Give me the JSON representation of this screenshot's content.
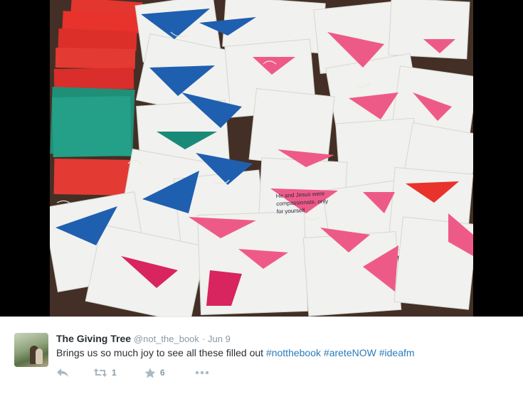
{
  "tweet": {
    "display_name": "The Giving Tree",
    "handle": "@not_the_book",
    "separator": "·",
    "date": "Jun 9",
    "text": "Brings us so much joy to see all these filled out",
    "hashtags": [
      "#notthebook",
      "#areteNOW",
      "#ideafm"
    ],
    "retweet_count": "1",
    "favorite_count": "6"
  },
  "icons": {
    "reply": "reply-icon",
    "retweet": "retweet-icon",
    "favorite": "star-icon",
    "more": "more-icon"
  },
  "colors": {
    "hashtag": "#2b7bb9",
    "meta": "#8899a6",
    "icon": "#aab8c2",
    "envelope_red": "#e8322c",
    "envelope_blue": "#1f5fb0",
    "envelope_pink": "#ee5a88",
    "envelope_teal": "#1a8a78"
  },
  "photo": {
    "card_text": [
      "He and Jesus were",
      "compassionate, only",
      "for yourself"
    ]
  }
}
